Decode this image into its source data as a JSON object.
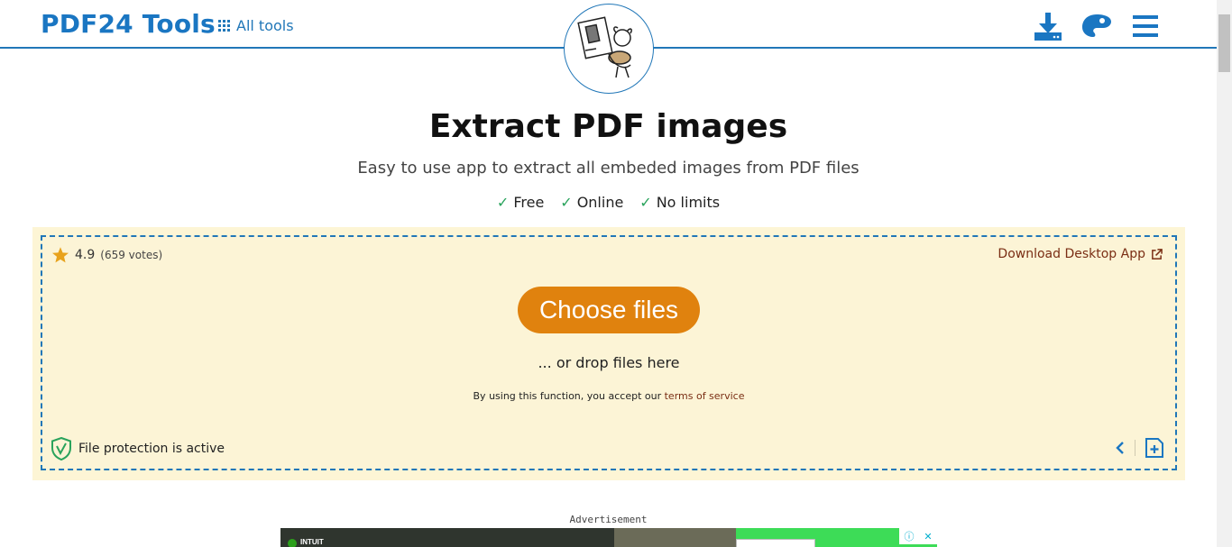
{
  "header": {
    "logo": "PDF24 Tools",
    "all_tools": "All tools",
    "icons": [
      "download-icon",
      "palette-icon",
      "menu-icon"
    ]
  },
  "main": {
    "title": "Extract PDF images",
    "subtitle": "Easy to use app to extract all embeded images from PDF files",
    "features": [
      "Free",
      "Online",
      "No limits"
    ]
  },
  "dropzone": {
    "rating": "4.9",
    "votes": "(659 votes)",
    "desktop_app": "Download Desktop App",
    "choose_files": "Choose files",
    "drop_text": "... or drop files here",
    "tos_prefix": "By using this function, you accept our",
    "tos_link": "terms of service",
    "protection": "File protection is active"
  },
  "ad": {
    "label": "Advertisement",
    "brand": "INTUIT"
  },
  "colors": {
    "brand": "#1a76c2",
    "accent_orange": "#e0820e",
    "zone_bg": "#fcf4d6",
    "check_green": "#29a35c",
    "link_brown": "#7a2e14"
  }
}
